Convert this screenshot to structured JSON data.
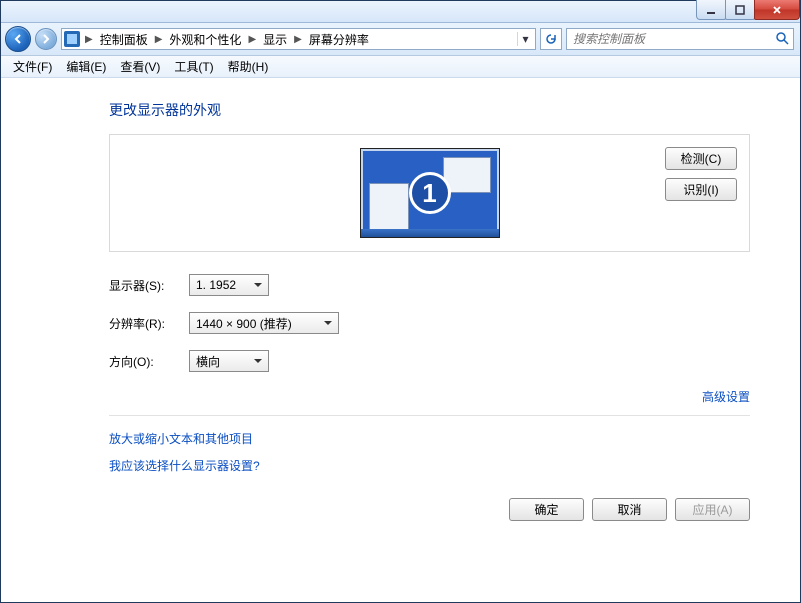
{
  "titlebar": {
    "min": "",
    "max": "",
    "close": ""
  },
  "nav": {
    "breadcrumb": [
      "控制面板",
      "外观和个性化",
      "显示",
      "屏幕分辨率"
    ],
    "search_placeholder": "搜索控制面板"
  },
  "menu": {
    "file": "文件(F)",
    "edit": "编辑(E)",
    "view": "查看(V)",
    "tools": "工具(T)",
    "help": "帮助(H)"
  },
  "page": {
    "heading": "更改显示器的外观",
    "detect": "检测(C)",
    "identify": "识别(I)",
    "monitor_number": "1",
    "display_label": "显示器(S):",
    "display_value": "1. 1952",
    "resolution_label": "分辨率(R):",
    "resolution_value": "1440 × 900 (推荐)",
    "orientation_label": "方向(O):",
    "orientation_value": "横向",
    "advanced": "高级设置",
    "link_textsize": "放大或缩小文本和其他项目",
    "link_whichsettings": "我应该选择什么显示器设置?",
    "ok": "确定",
    "cancel": "取消",
    "apply": "应用(A)"
  }
}
